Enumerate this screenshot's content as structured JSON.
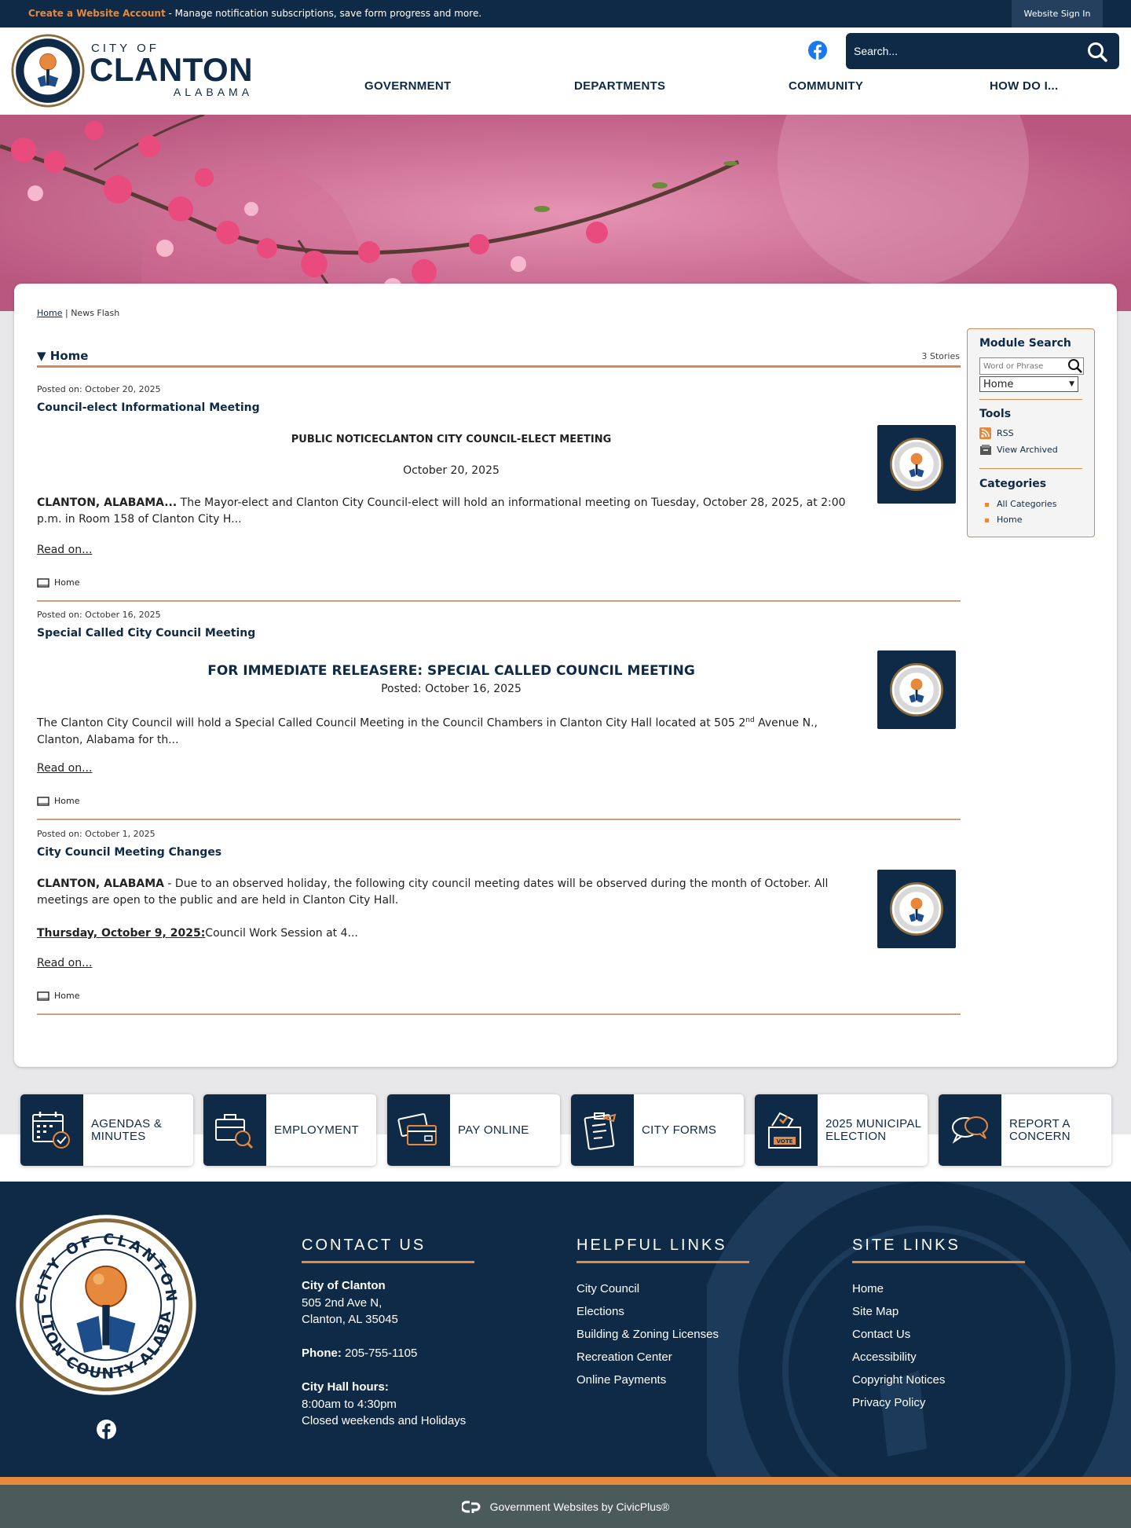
{
  "topbar": {
    "create_account": "Create a Website Account",
    "create_account_rest": " - Manage notification subscriptions, save form progress and more.",
    "sign_in": "Website Sign In"
  },
  "header": {
    "brand_city_of": "CITY OF",
    "brand_name": "CLANTON",
    "brand_state": "ALABAMA",
    "search_placeholder": "Search...",
    "nav": [
      "GOVERNMENT",
      "DEPARTMENTS",
      "COMMUNITY",
      "HOW DO I..."
    ]
  },
  "breadcrumb": {
    "home": "Home",
    "separator": "|",
    "current": "News Flash"
  },
  "section": {
    "title": "Home",
    "stories": "3 Stories"
  },
  "items": [
    {
      "posted": "Posted on: October 20, 2025",
      "title": "Council-elect Informational Meeting",
      "headline": "PUBLIC NOTICECLANTON CITY COUNCIL-ELECT MEETING",
      "date_line": "October 20, 2025",
      "lead": "CLANTON, ALABAMA...",
      "body": " The Mayor-elect and Clanton City Council-elect will hold an informational meeting on Tuesday, October 28, 2025, at 2:00 p.m. in Room 158 of Clanton City H...",
      "read_on": "Read on...",
      "category": "Home"
    },
    {
      "posted": "Posted on: October 16, 2025",
      "title": "Special Called City Council Meeting",
      "headline": "FOR IMMEDIATE RELEASERE: SPECIAL CALLED COUNCIL MEETING",
      "date_line": "Posted: October 16, 2025",
      "body_a": "The Clanton City Council will hold a Special Called Council Meeting in the Council Chambers in Clanton City Hall located at 505 2",
      "body_sup": "nd",
      "body_b": " Avenue N., Clanton, Alabama for th...",
      "read_on": "Read on...",
      "category": "Home"
    },
    {
      "posted": "Posted on: October 1, 2025",
      "title": "City Council Meeting Changes",
      "lead": "CLANTON, ALABAMA",
      "body": " - Due to an observed holiday, the following city council meeting dates will be observed during the month of October. All meetings are open to the public and are held in Clanton City Hall.",
      "sub_lead": "Thursday, October 9, 2025:",
      "sub_body": "Council Work Session at 4...",
      "read_on": "Read on...",
      "category": "Home"
    }
  ],
  "sidebar": {
    "module_search": "Module Search",
    "search_placeholder": "Word or Phrase",
    "select_value": "Home",
    "tools": "Tools",
    "rss": "RSS",
    "view_archived": "View Archived",
    "categories": "Categories",
    "all_categories": "All Categories",
    "home": "Home"
  },
  "quick_links": [
    {
      "label": "AGENDAS & MINUTES",
      "icon": "calendar-icon"
    },
    {
      "label": "EMPLOYMENT",
      "icon": "briefcase-icon"
    },
    {
      "label": "PAY ONLINE",
      "icon": "credit-card-icon"
    },
    {
      "label": "CITY FORMS",
      "icon": "clipboard-icon"
    },
    {
      "label": "2025 MUNICIPAL ELECTION",
      "icon": "ballot-box-icon"
    },
    {
      "label": "REPORT A CONCERN",
      "icon": "speech-bubbles-icon"
    }
  ],
  "footer": {
    "contact_title": "CONTACT US",
    "org": "City of Clanton",
    "addr1": "505 2nd Ave N,",
    "addr2": "Clanton, AL 35045",
    "phone_label": "Phone:",
    "phone": " 205-755-1105",
    "hours_label": "City Hall hours:",
    "hours1": "8:00am to 4:30pm",
    "hours2": "Closed weekends and Holidays",
    "helpful_title": "HELPFUL LINKS",
    "helpful": [
      "City Council",
      "Elections",
      "Building & Zoning Licenses",
      "Recreation Center",
      "Online Payments"
    ],
    "site_title": "SITE LINKS",
    "site": [
      "Home",
      "Site Map",
      "Contact Us",
      "Accessibility",
      "Copyright Notices",
      "Privacy Policy"
    ],
    "credit": "Government Websites by CivicPlus®"
  },
  "colors": {
    "navy": "#0f2a46",
    "orange": "#e6893c",
    "rule": "#d48a52",
    "facebook": "#1877f2"
  }
}
